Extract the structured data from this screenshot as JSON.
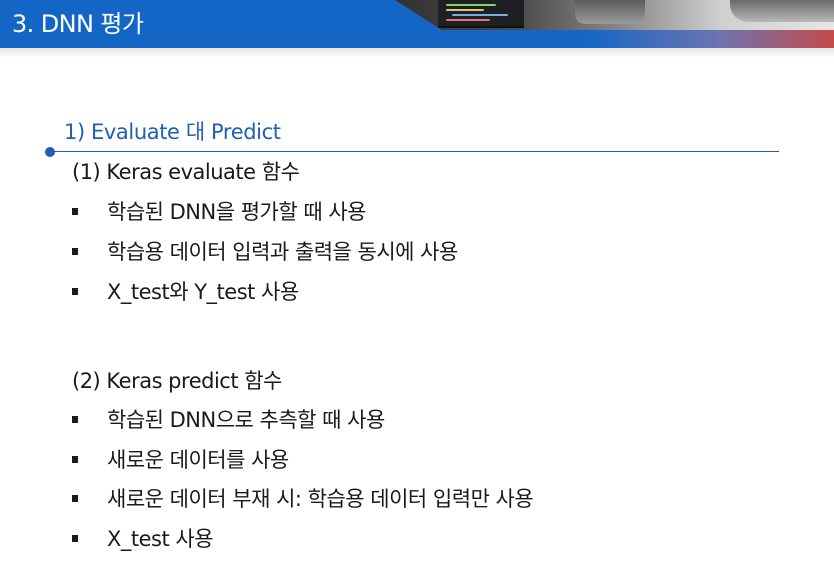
{
  "header": {
    "title": "3. DNN 평가"
  },
  "section": {
    "heading": "1) Evaluate 대 Predict"
  },
  "groups": [
    {
      "heading": "(1) Keras evaluate 함수",
      "bullets": [
        "학습된 DNN을 평가할 때 사용",
        "학습용 데이터 입력과 출력을 동시에 사용",
        "X_test와 Y_test 사용"
      ]
    },
    {
      "heading": "(2) Keras predict 함수",
      "bullets": [
        "학습된 DNN으로 추측할 때 사용",
        "새로운 데이터를 사용",
        "새로운 데이터 부재 시: 학습용 데이터 입력만 사용",
        "X_test 사용"
      ]
    }
  ],
  "colors": {
    "header_blue": "#1466c6",
    "accent_blue": "#1f5fb5",
    "accent_red": "#c64a4a",
    "text": "#1a1a1a"
  },
  "icons": {
    "bullet": "square-bullet-icon",
    "section_marker": "dot-icon"
  }
}
